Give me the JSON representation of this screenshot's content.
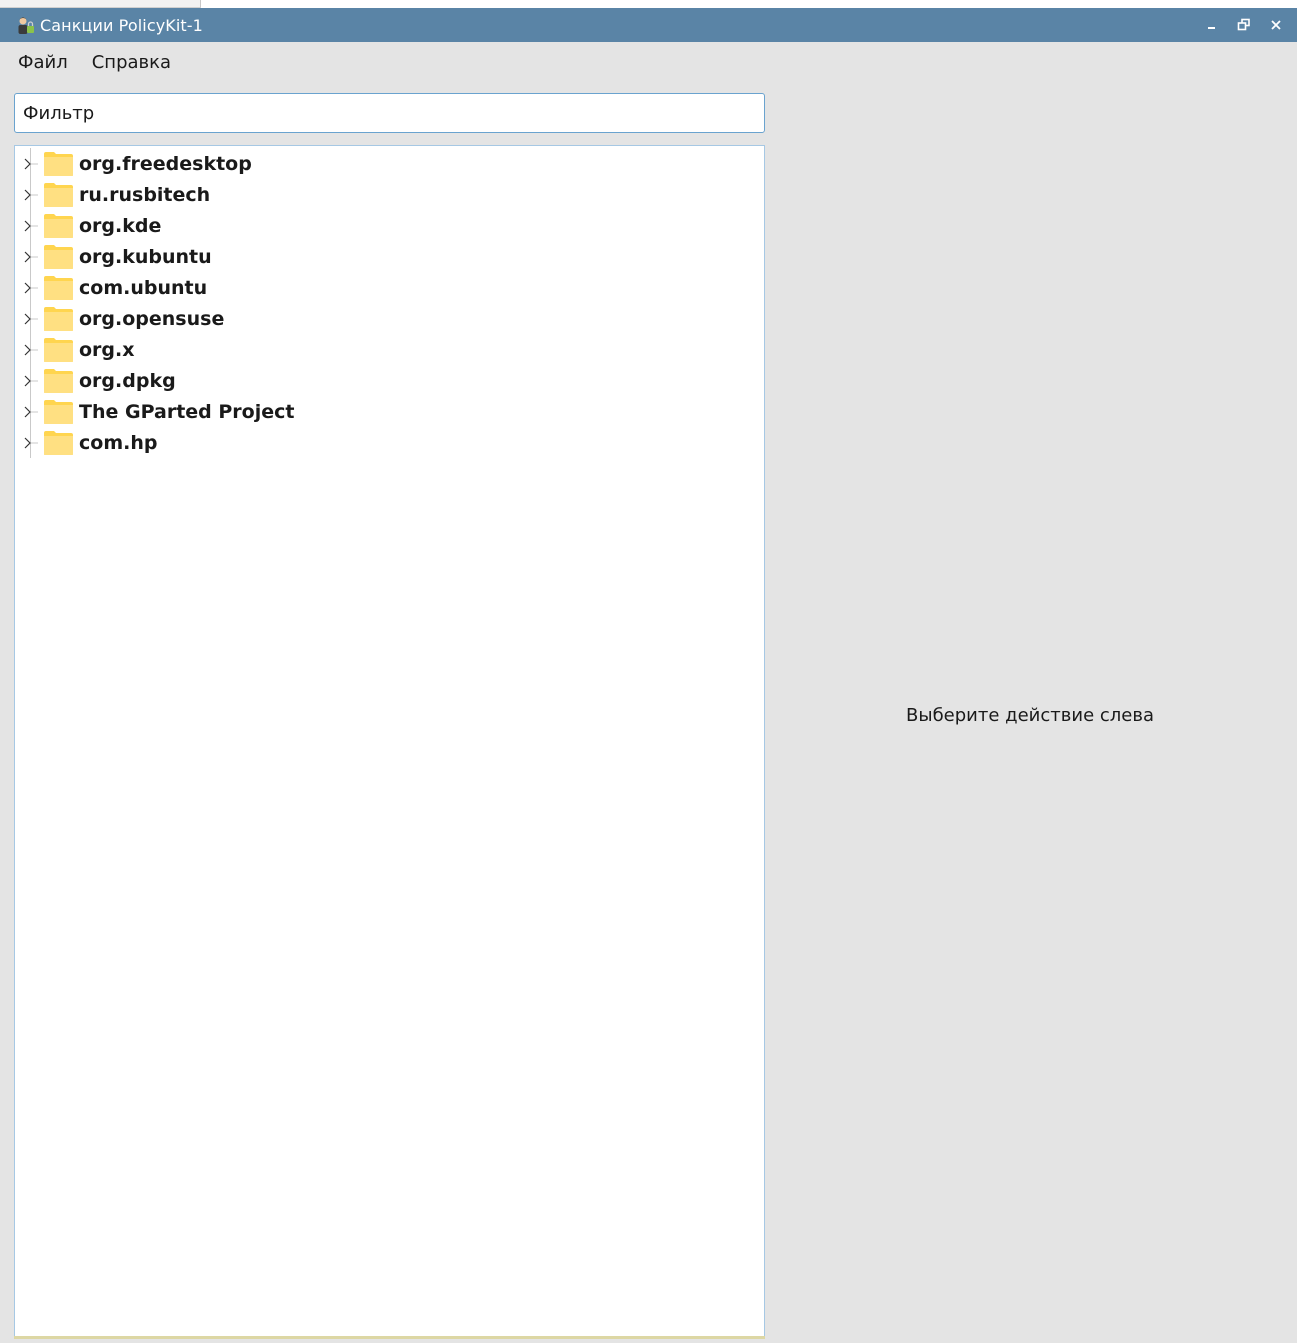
{
  "window": {
    "title": "Санкции PolicyKit-1",
    "minimize_icon": "minimize-icon",
    "maximize_icon": "restore-icon",
    "close_icon": "close-icon"
  },
  "menubar": {
    "items": [
      {
        "label": "Файл"
      },
      {
        "label": "Справка"
      }
    ]
  },
  "filter": {
    "placeholder": "Фильтр",
    "value": ""
  },
  "tree": {
    "items": [
      {
        "label": "org.freedesktop",
        "icon": "folder-icon",
        "expanded": false
      },
      {
        "label": "ru.rusbitech",
        "icon": "folder-icon",
        "expanded": false
      },
      {
        "label": "org.kde",
        "icon": "folder-icon",
        "expanded": false
      },
      {
        "label": "org.kubuntu",
        "icon": "folder-icon",
        "expanded": false
      },
      {
        "label": "com.ubuntu",
        "icon": "folder-icon",
        "expanded": false
      },
      {
        "label": "org.opensuse",
        "icon": "folder-icon",
        "expanded": false
      },
      {
        "label": "org.x",
        "icon": "folder-icon",
        "expanded": false
      },
      {
        "label": "org.dpkg",
        "icon": "folder-icon",
        "expanded": false
      },
      {
        "label": "The GParted Project",
        "icon": "folder-icon",
        "expanded": false
      },
      {
        "label": "com.hp",
        "icon": "folder-icon",
        "expanded": false
      }
    ]
  },
  "detail": {
    "message": "Выберите действие слева"
  },
  "colors": {
    "titlebar": "#5a84a6",
    "window_bg": "#e4e4e4",
    "focus_border": "#6aa3cf",
    "folder": "#ffd54f"
  }
}
